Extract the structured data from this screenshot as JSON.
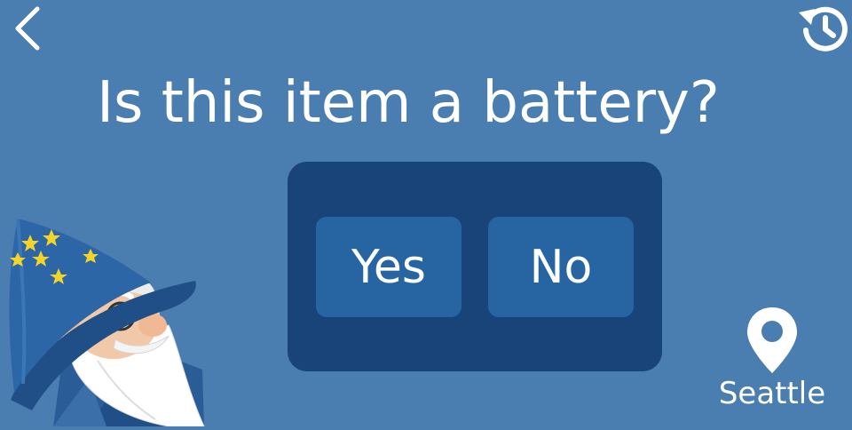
{
  "question": "Is this item a battery?",
  "answers": {
    "yes_label": "Yes",
    "no_label": "No"
  },
  "location": {
    "city": "Seattle"
  },
  "icons": {
    "back": "chevron-left-icon",
    "history": "history-icon",
    "location": "location-pin-icon",
    "mascot": "wizard-mascot"
  },
  "colors": {
    "background": "#4a7db0",
    "panel": "#18447a",
    "button": "#2765a2",
    "text": "#ffffff"
  }
}
